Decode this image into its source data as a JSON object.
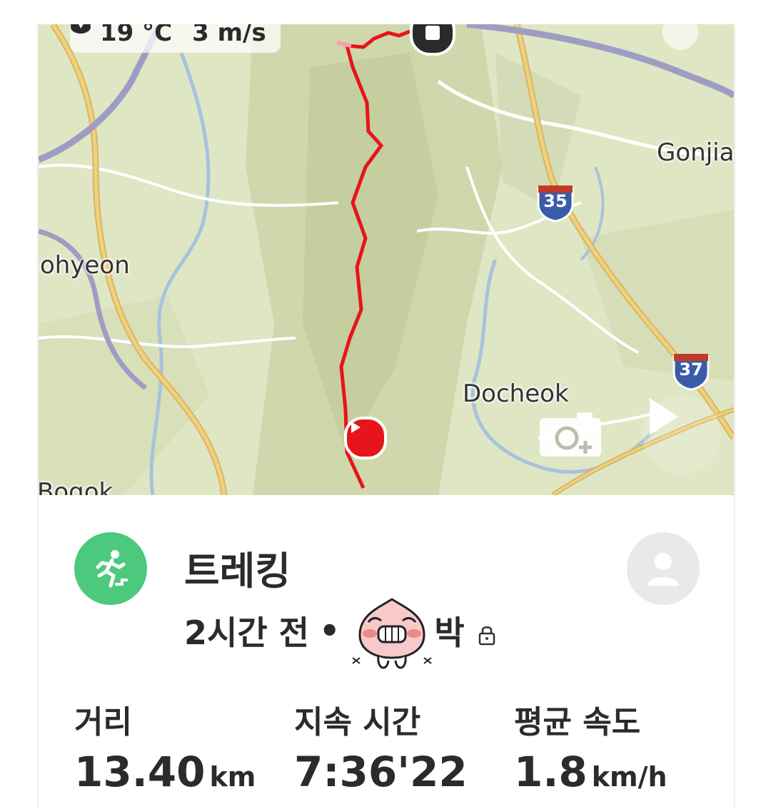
{
  "map": {
    "weather": {
      "icon": "partly-cloudy-icon",
      "temperature": "19 °C",
      "wind_icon": "wind-direction-icon",
      "wind_speed": "3 m/s"
    },
    "places": [
      "Gonjia",
      "ohyeon",
      "Docheok",
      "Bogok"
    ],
    "highway_shields": [
      "35",
      "37"
    ],
    "route_color": "#e8141b",
    "start_marker_icon": "start-play-icon",
    "end_marker_icon": "stop-icon",
    "add_photo_icon": "add-photo-icon",
    "replay_icon": "play-icon"
  },
  "activity": {
    "type_icon": "running-person-icon",
    "accent_color": "#4cc97d",
    "title": "트레킹",
    "time_ago": "2시간 전",
    "separator": "•",
    "user_emoji": "peach-character-icon",
    "user_name": "박",
    "privacy_icon": "lock-icon",
    "profile_icon": "profile-avatar-icon"
  },
  "stats": [
    {
      "label": "거리",
      "value": "13.40",
      "unit": "km"
    },
    {
      "label": "지속 시간",
      "value": "7:36'22",
      "unit": ""
    },
    {
      "label": "평균 속도",
      "value": "1.8",
      "unit": "km/h"
    }
  ]
}
